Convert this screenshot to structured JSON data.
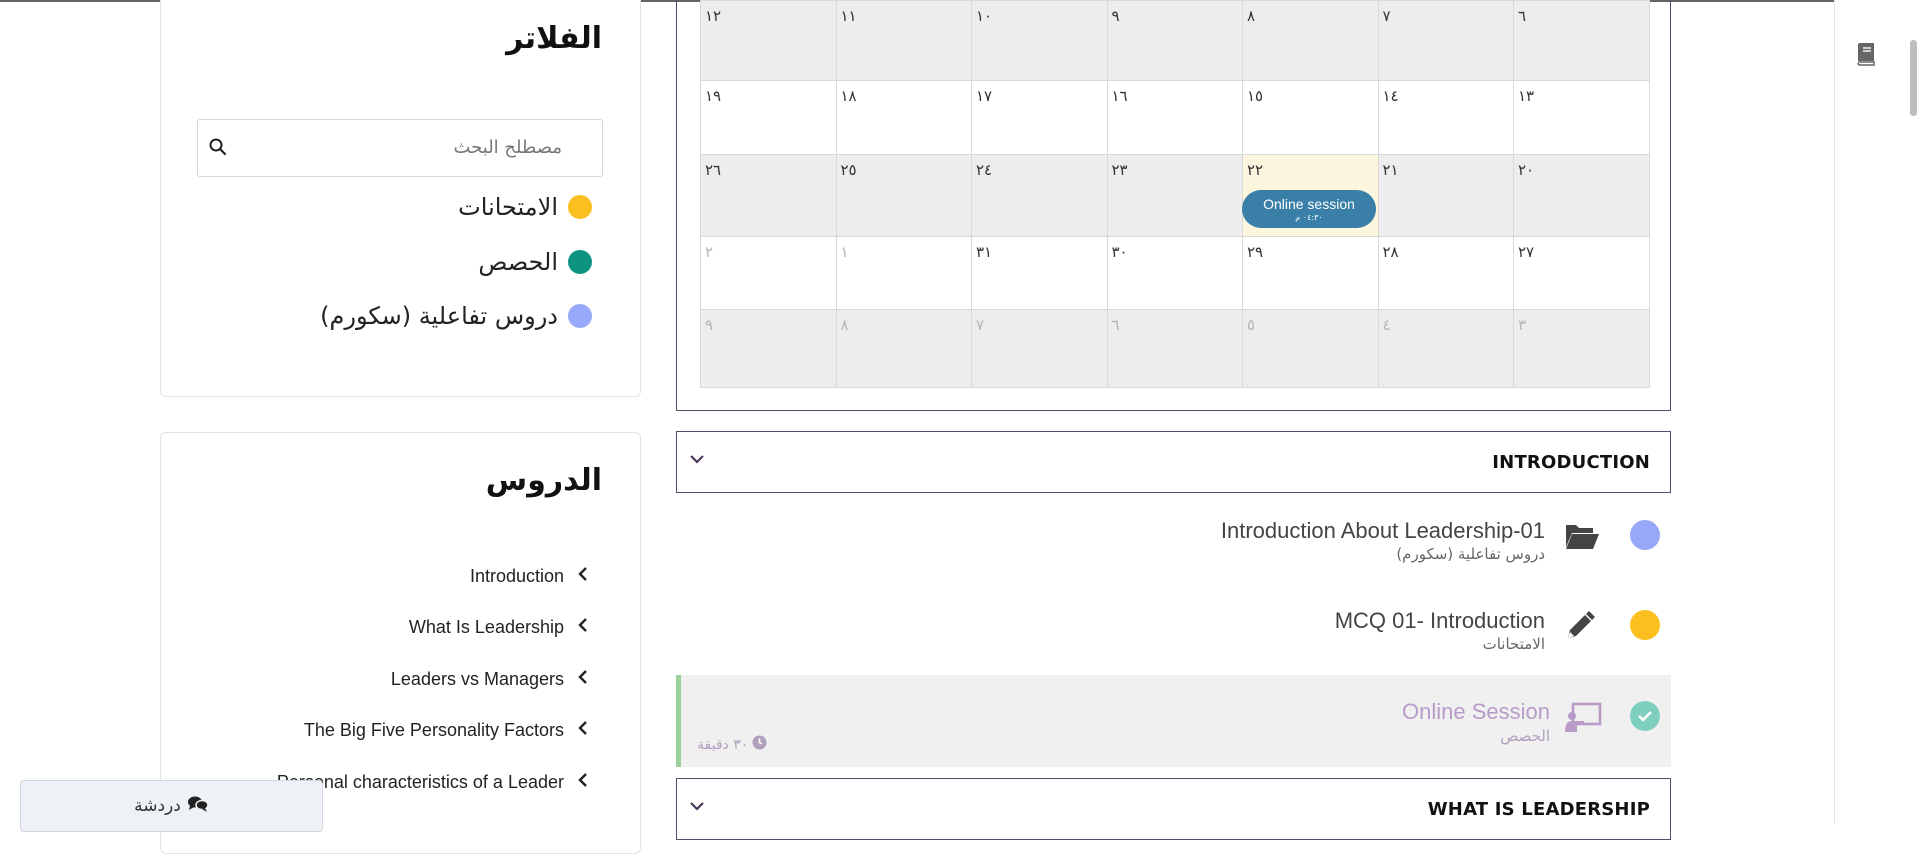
{
  "filters": {
    "title": "الفلاتر",
    "search_placeholder": "مصطلح البحث",
    "legend": [
      {
        "label": "الامتحانات",
        "color": "#fbbf1f"
      },
      {
        "label": "الحصص",
        "color": "#0d9480"
      },
      {
        "label": "دروس تفاعلية (سكورم)",
        "color": "#98a8f8"
      }
    ]
  },
  "lessons": {
    "title": "الدروس",
    "items": [
      "Introduction",
      "What Is Leadership",
      "Leaders vs Managers",
      "The Big Five Personality Factors",
      "Personal characteristics of a Leader"
    ]
  },
  "chat": {
    "label": "دردشة"
  },
  "calendar": {
    "rows": [
      [
        {
          "n": "١٢",
          "m": false
        },
        {
          "n": "١١",
          "m": false
        },
        {
          "n": "١٠",
          "m": false
        },
        {
          "n": "٩",
          "m": false
        },
        {
          "n": "٨",
          "m": false
        },
        {
          "n": "٧",
          "m": false
        },
        {
          "n": "٦",
          "m": false
        }
      ],
      [
        {
          "n": "١٩",
          "m": false
        },
        {
          "n": "١٨",
          "m": false
        },
        {
          "n": "١٧",
          "m": false
        },
        {
          "n": "١٦",
          "m": false
        },
        {
          "n": "١٥",
          "m": false
        },
        {
          "n": "١٤",
          "m": false
        },
        {
          "n": "١٣",
          "m": false
        }
      ],
      [
        {
          "n": "٢٦",
          "m": false
        },
        {
          "n": "٢٥",
          "m": false
        },
        {
          "n": "٢٤",
          "m": false
        },
        {
          "n": "٢٣",
          "m": false
        },
        {
          "n": "٢٢",
          "m": false,
          "today": true
        },
        {
          "n": "٢١",
          "m": false
        },
        {
          "n": "٢٠",
          "m": false
        }
      ],
      [
        {
          "n": "٢",
          "m": true
        },
        {
          "n": "١",
          "m": true
        },
        {
          "n": "٣١",
          "m": false
        },
        {
          "n": "٣٠",
          "m": false
        },
        {
          "n": "٢٩",
          "m": false
        },
        {
          "n": "٢٨",
          "m": false
        },
        {
          "n": "٢٧",
          "m": false
        }
      ],
      [
        {
          "n": "٩",
          "m": true
        },
        {
          "n": "٨",
          "m": true
        },
        {
          "n": "٧",
          "m": true
        },
        {
          "n": "٦",
          "m": true
        },
        {
          "n": "٥",
          "m": true
        },
        {
          "n": "٤",
          "m": true
        },
        {
          "n": "٣",
          "m": true
        }
      ]
    ],
    "event": {
      "title": "Online session",
      "time": "٠٤:٣٠ م"
    }
  },
  "sections": [
    {
      "title": "INTRODUCTION"
    },
    {
      "title": "WHAT IS LEADERSHIP"
    }
  ],
  "intro_items": [
    {
      "title": "Introduction About Leadership-01",
      "type": "دروس تفاعلية (سكورم)",
      "color": "#98a8f8",
      "icon": "folder-open-icon"
    },
    {
      "title": "MCQ 01- Introduction",
      "type": "الامتحانات",
      "color": "#fbbf1f",
      "icon": "pencil-icon"
    },
    {
      "title": "Online Session",
      "type": "الحصص",
      "color": "#7fcfc0",
      "icon": "presentation-icon",
      "completed": true,
      "duration": "٣٠ دقيقة"
    }
  ]
}
